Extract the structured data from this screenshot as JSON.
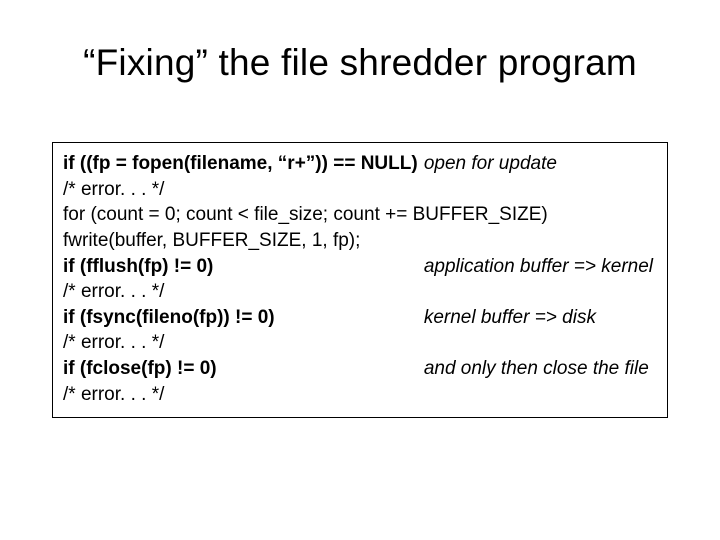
{
  "title": "“Fixing” the file shredder program",
  "lines": {
    "l1_left": "if ((fp = fopen(filename, “r+”)) == NULL)",
    "l1_right": "open for update",
    "l2": "/* error. . . */",
    "l3": "for (count = 0; count < file_size; count += BUFFER_SIZE)",
    "l4": "fwrite(buffer, BUFFER_SIZE, 1, fp);",
    "l5_left": "if (fflush(fp) != 0)",
    "l5_right": "application buffer => kernel",
    "l6": "/* error. . . */",
    "l7_left": "if (fsync(fileno(fp)) != 0)",
    "l7_right": "kernel buffer => disk",
    "l8": "/* error. . . */",
    "l9_left": "if (fclose(fp) != 0)",
    "l9_right": "and only then close the file",
    "l10": "/* error. . . */"
  }
}
